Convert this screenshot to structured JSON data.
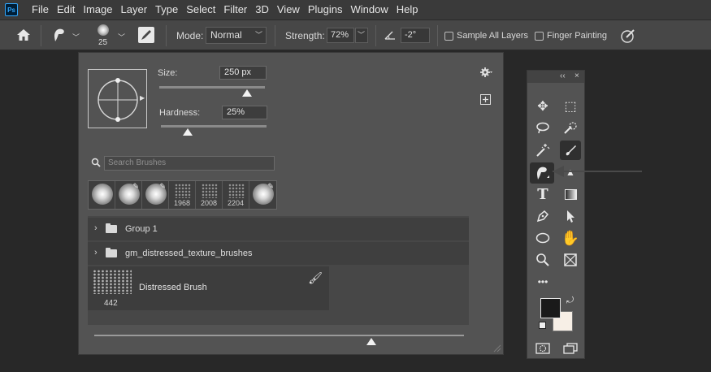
{
  "menu": {
    "logo": "Ps",
    "items": [
      "File",
      "Edit",
      "Image",
      "Layer",
      "Type",
      "Select",
      "Filter",
      "3D",
      "View",
      "Plugins",
      "Window",
      "Help"
    ]
  },
  "options": {
    "brush_size": "25",
    "mode_label": "Mode:",
    "mode_value": "Normal",
    "strength_label": "Strength:",
    "strength_value": "72%",
    "angle_value": "-2°",
    "sample_all_layers": "Sample All Layers",
    "finger_painting": "Finger Painting"
  },
  "brush_panel": {
    "size_label": "Size:",
    "size_value": "250 px",
    "size_slider_fraction": 0.83,
    "hardness_label": "Hardness:",
    "hardness_value": "25%",
    "hardness_slider_fraction": 0.25,
    "search_placeholder": "Search Brushes",
    "recent_brushes": [
      {
        "number": ""
      },
      {
        "number": ""
      },
      {
        "number": ""
      },
      {
        "number": "1968"
      },
      {
        "number": "2008"
      },
      {
        "number": "2204"
      },
      {
        "number": ""
      }
    ],
    "groups": [
      {
        "label": "Group 1"
      },
      {
        "label": "gm_distressed_texture_brushes"
      }
    ],
    "brush": {
      "name": "Distressed Brush",
      "number": "442"
    },
    "scroll_fraction": 0.75
  },
  "tools_panel": {
    "header_collapse": "‹‹",
    "header_close": "×",
    "more_label": "•••"
  },
  "colors": {
    "foreground": "#1a1a1a",
    "background": "#f7efe6",
    "ps_accent": "#31a8ff"
  },
  "icons": {
    "home": "home-icon",
    "smudge": "smudge-tool-icon",
    "gear": "gear-icon"
  }
}
